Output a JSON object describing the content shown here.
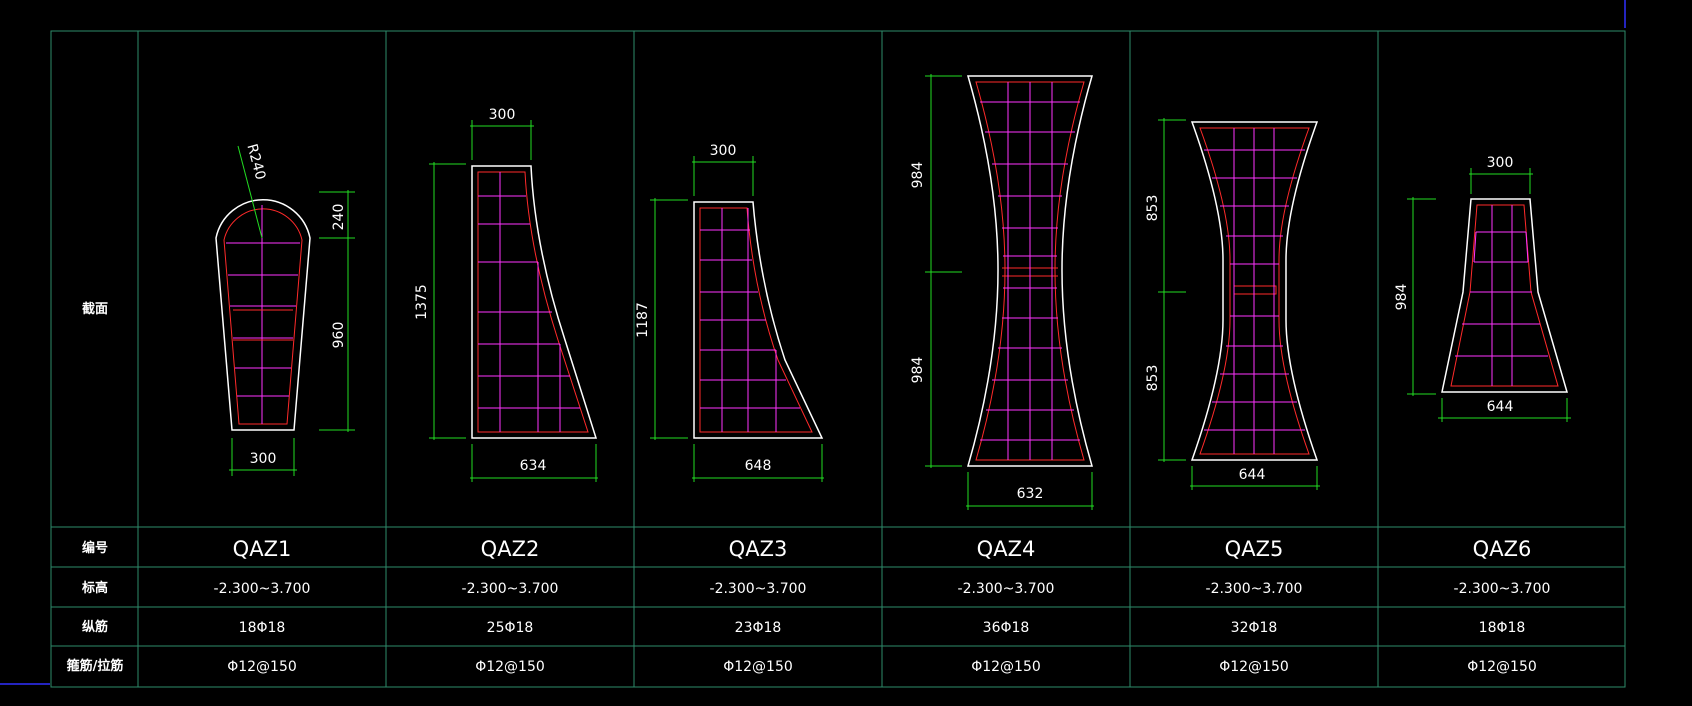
{
  "table": {
    "row_labels": {
      "section": "截面",
      "id": "编号",
      "elevation": "标高",
      "longitudinal": "纵筋",
      "stirrup": "箍筋/拉筋"
    },
    "columns": [
      {
        "id": "QAZ1",
        "elevation": "-2.300~3.700",
        "longitudinal": "18Φ18",
        "stirrup": "Φ12@150",
        "dims": {
          "radius": "R240",
          "arc_height": "240",
          "height": "960",
          "bottom_width": "300"
        }
      },
      {
        "id": "QAZ2",
        "elevation": "-2.300~3.700",
        "longitudinal": "25Φ18",
        "stirrup": "Φ12@150",
        "dims": {
          "top_width": "300",
          "height": "1375",
          "bottom_width": "634"
        }
      },
      {
        "id": "QAZ3",
        "elevation": "-2.300~3.700",
        "longitudinal": "23Φ18",
        "stirrup": "Φ12@150",
        "dims": {
          "top_width": "300",
          "height": "1187",
          "bottom_width": "648"
        }
      },
      {
        "id": "QAZ4",
        "elevation": "-2.300~3.700",
        "longitudinal": "36Φ18",
        "stirrup": "Φ12@150",
        "dims": {
          "upper_height": "984",
          "lower_height": "984",
          "bottom_width": "632"
        }
      },
      {
        "id": "QAZ5",
        "elevation": "-2.300~3.700",
        "longitudinal": "32Φ18",
        "stirrup": "Φ12@150",
        "dims": {
          "upper_height": "853",
          "lower_height": "853",
          "bottom_width": "644"
        }
      },
      {
        "id": "QAZ6",
        "elevation": "-2.300~3.700",
        "longitudinal": "18Φ18",
        "stirrup": "Φ12@150",
        "dims": {
          "top_width": "300",
          "height": "984",
          "bottom_width": "644"
        }
      }
    ]
  },
  "colors": {
    "background": "#000000",
    "grid": "#2e8b6a",
    "outline": "#ffffff",
    "rebar": "#ff2a2a",
    "stirrup": "#ff33ff",
    "dimension": "#22dd22",
    "viewport_edge": "#3030ff"
  }
}
